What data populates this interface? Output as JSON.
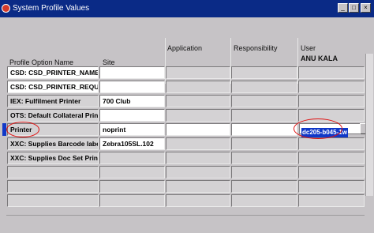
{
  "window": {
    "title": "System Profile Values"
  },
  "columns": {
    "profile_option_name": "Profile Option Name",
    "site": "Site",
    "application": "Application",
    "responsibility": "Responsibility",
    "user": "User"
  },
  "user_header_value": "ANU KALA",
  "rows": [
    {
      "name": "CSD: CSD_PRINTER_NAME",
      "site": "",
      "user": ""
    },
    {
      "name": "CSD: CSD_PRINTER_REQUIRED",
      "site": "",
      "user": ""
    },
    {
      "name": "IEX: Fulfilment Printer",
      "site": "700 Club",
      "user": ""
    },
    {
      "name": "OTS: Default Collateral Printer Name",
      "site": "",
      "user": ""
    },
    {
      "name": "Printer",
      "site": "noprint",
      "user": "dc205-b045-1w"
    },
    {
      "name": "XXC: Supplies Barcode label Printer",
      "site": "Zebra105SL.102",
      "user": ""
    },
    {
      "name": "XXC: Supplies Doc Set Printer",
      "site": "",
      "user": ""
    },
    {
      "name": "",
      "site": "",
      "user": ""
    },
    {
      "name": "",
      "site": "",
      "user": ""
    },
    {
      "name": "",
      "site": "",
      "user": ""
    }
  ],
  "colors": {
    "titlebar": "#0a2a86",
    "selection": "#1038c8",
    "annotation": "#e01010"
  }
}
